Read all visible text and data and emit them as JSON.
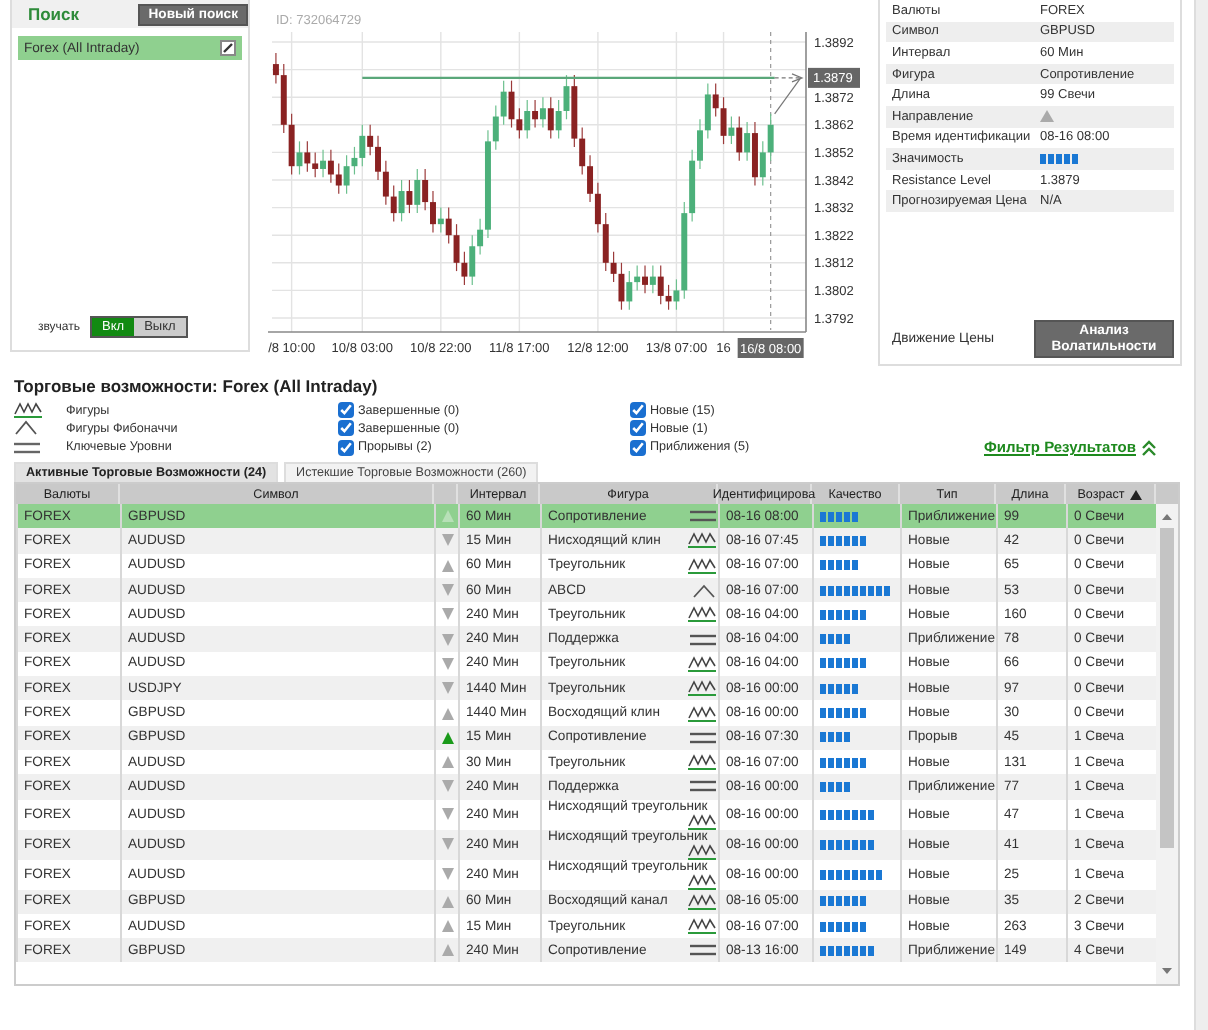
{
  "search_panel": {
    "title": "Поиск",
    "new_search_button": "Новый поиск",
    "items": [
      {
        "label": "Forex (All Intraday)",
        "selected": true
      }
    ],
    "sound_label": "звучать",
    "sound_options": [
      {
        "label": "Вкл",
        "selected": true
      },
      {
        "label": "Выкл",
        "selected": false
      }
    ]
  },
  "chart": {
    "id_label": "ID: 732064729",
    "chart_data": {
      "type": "candlestick",
      "ylim": [
        1.3792,
        1.3892
      ],
      "grid": true,
      "categories": [
        null,
        null,
        "/8 10:00",
        null,
        null,
        null,
        null,
        null,
        null,
        null,
        null,
        "10/8 03:00",
        null,
        null,
        null,
        null,
        null,
        null,
        null,
        null,
        null,
        "10/8 22:00",
        null,
        null,
        null,
        null,
        null,
        null,
        null,
        null,
        null,
        "11/8 17:00",
        null,
        null,
        null,
        null,
        null,
        null,
        null,
        null,
        null,
        "12/8 12:00",
        null,
        null,
        null,
        null,
        null,
        null,
        null,
        null,
        null,
        "13/8 07:00",
        null,
        null,
        null,
        null,
        null,
        "16",
        null,
        null,
        null,
        null,
        null,
        "16/8 08:00",
        null,
        null,
        null,
        null
      ],
      "yticks": [
        1.3892,
        1.3872,
        1.3862,
        1.3852,
        1.3842,
        1.3832,
        1.3822,
        1.3812,
        1.3802,
        1.3792
      ],
      "ref_lines": [
        {
          "axis": "y",
          "value": 1.3879,
          "label": "1.3879",
          "color": "#5aa77a"
        }
      ],
      "ohlc": [
        [
          1.3884,
          1.3888,
          1.3877,
          1.388
        ],
        [
          1.388,
          1.3884,
          1.3859,
          1.3862
        ],
        [
          1.3862,
          1.3866,
          1.3844,
          1.3847
        ],
        [
          1.3847,
          1.3856,
          1.3844,
          1.3852
        ],
        [
          1.3852,
          1.3856,
          1.3845,
          1.3848
        ],
        [
          1.3848,
          1.3852,
          1.3843,
          1.3846
        ],
        [
          1.3846,
          1.3853,
          1.3843,
          1.3849
        ],
        [
          1.3849,
          1.3853,
          1.3841,
          1.3844
        ],
        [
          1.3844,
          1.3848,
          1.3837,
          1.384
        ],
        [
          1.384,
          1.3851,
          1.3837,
          1.3847
        ],
        [
          1.3847,
          1.3854,
          1.3844,
          1.385
        ],
        [
          1.385,
          1.3862,
          1.3847,
          1.3858
        ],
        [
          1.3858,
          1.3862,
          1.3851,
          1.3854
        ],
        [
          1.3854,
          1.3858,
          1.3842,
          1.3845
        ],
        [
          1.3845,
          1.3849,
          1.3833,
          1.3836
        ],
        [
          1.3836,
          1.384,
          1.3827,
          1.383
        ],
        [
          1.383,
          1.3842,
          1.3827,
          1.3838
        ],
        [
          1.3838,
          1.3842,
          1.383,
          1.3833
        ],
        [
          1.3833,
          1.3846,
          1.383,
          1.3842
        ],
        [
          1.3842,
          1.3846,
          1.3831,
          1.3834
        ],
        [
          1.3834,
          1.3838,
          1.3823,
          1.3826
        ],
        [
          1.3826,
          1.3832,
          1.3823,
          1.3828
        ],
        [
          1.3828,
          1.3832,
          1.3819,
          1.3822
        ],
        [
          1.3822,
          1.3826,
          1.3809,
          1.3812
        ],
        [
          1.3812,
          1.3816,
          1.3804,
          1.3807
        ],
        [
          1.3807,
          1.3822,
          1.3804,
          1.3818
        ],
        [
          1.3818,
          1.3828,
          1.3815,
          1.3824
        ],
        [
          1.3824,
          1.386,
          1.3821,
          1.3856
        ],
        [
          1.3856,
          1.3869,
          1.3853,
          1.3865
        ],
        [
          1.3865,
          1.3878,
          1.3862,
          1.3874
        ],
        [
          1.3874,
          1.3878,
          1.3861,
          1.3864
        ],
        [
          1.3864,
          1.3868,
          1.3857,
          1.386
        ],
        [
          1.386,
          1.3871,
          1.3857,
          1.3867
        ],
        [
          1.3867,
          1.3871,
          1.3861,
          1.3864
        ],
        [
          1.3864,
          1.3872,
          1.3861,
          1.3868
        ],
        [
          1.3868,
          1.3872,
          1.3857,
          1.386
        ],
        [
          1.386,
          1.3871,
          1.3857,
          1.3867
        ],
        [
          1.3867,
          1.388,
          1.3864,
          1.3876
        ],
        [
          1.3876,
          1.388,
          1.3854,
          1.3857
        ],
        [
          1.3857,
          1.3861,
          1.3844,
          1.3847
        ],
        [
          1.3847,
          1.3851,
          1.3834,
          1.3837
        ],
        [
          1.3837,
          1.3841,
          1.3823,
          1.3826
        ],
        [
          1.3826,
          1.383,
          1.3809,
          1.3812
        ],
        [
          1.3812,
          1.3816,
          1.3805,
          1.3808
        ],
        [
          1.3808,
          1.3812,
          1.3795,
          1.3798
        ],
        [
          1.3798,
          1.3809,
          1.3795,
          1.3805
        ],
        [
          1.3805,
          1.3811,
          1.3802,
          1.3807
        ],
        [
          1.3807,
          1.3811,
          1.3801,
          1.3804
        ],
        [
          1.3804,
          1.3811,
          1.3801,
          1.3807
        ],
        [
          1.3807,
          1.3811,
          1.3797,
          1.38
        ],
        [
          1.38,
          1.3804,
          1.3795,
          1.3798
        ],
        [
          1.3798,
          1.3806,
          1.3795,
          1.3802
        ],
        [
          1.3802,
          1.3834,
          1.3799,
          1.383
        ],
        [
          1.383,
          1.3853,
          1.3827,
          1.3849
        ],
        [
          1.3849,
          1.3864,
          1.3846,
          1.386
        ],
        [
          1.386,
          1.3877,
          1.3857,
          1.3873
        ],
        [
          1.3873,
          1.3877,
          1.3865,
          1.3868
        ],
        [
          1.3868,
          1.3872,
          1.3855,
          1.3858
        ],
        [
          1.3858,
          1.3865,
          1.3855,
          1.3861
        ],
        [
          1.3861,
          1.3865,
          1.3849,
          1.3852
        ],
        [
          1.3852,
          1.3863,
          1.3849,
          1.3859
        ],
        [
          1.3859,
          1.3863,
          1.384,
          1.3843
        ],
        [
          1.3843,
          1.3856,
          1.384,
          1.3852
        ],
        [
          1.3852,
          1.3866,
          1.3849,
          1.3862
        ],
        null,
        null,
        null,
        null
      ]
    }
  },
  "details": {
    "rows": [
      {
        "label": "Валюты",
        "kind": "text",
        "value": "FOREX"
      },
      {
        "label": "Символ",
        "kind": "text",
        "value": "GBPUSD"
      },
      {
        "label": "Интервал",
        "kind": "text",
        "value": "60 Мин"
      },
      {
        "label": "Фигура",
        "kind": "text",
        "value": "Сопротивление"
      },
      {
        "label": "Длина",
        "kind": "text",
        "value": "99 Свечи"
      },
      {
        "label": "Направление",
        "kind": "direction",
        "up": true
      },
      {
        "label": "Время идентификации",
        "kind": "text",
        "value": "08-16 08:00"
      },
      {
        "label": "Значимость",
        "kind": "quality",
        "stars": 5
      },
      {
        "label": "Resistance Level",
        "kind": "text",
        "value": "1.3879"
      },
      {
        "label": "Прогнозируемая Цена",
        "kind": "text",
        "value": "N/A"
      }
    ],
    "footer_label": "Движение Цены",
    "volatility_button": "Анализ Волатильности"
  },
  "opportunities": {
    "title": "Торговые возможности: Forex (All Intraday)",
    "filters": [
      {
        "label": "Фигуры",
        "kind": "pattern",
        "options": [
          {
            "label": "Завершенные (0)",
            "checked": true
          },
          {
            "label": "Новые (15)",
            "checked": true
          }
        ]
      },
      {
        "label": "Фигуры Фибоначчи",
        "kind": "fib",
        "options": [
          {
            "label": "Завершенные (0)",
            "checked": true
          },
          {
            "label": "Новые (1)",
            "checked": true
          }
        ]
      },
      {
        "label": "Ключевые Уровни",
        "kind": "level",
        "options": [
          {
            "label": "Прорывы (2)",
            "checked": true
          },
          {
            "label": "Приближения (5)",
            "checked": true
          }
        ]
      }
    ],
    "filter_link": "Фильтр Результатов"
  },
  "tabs": [
    {
      "label": "Активные Торговые Возможности (24)",
      "selected": true
    },
    {
      "label": "Истекшие Торговые Возможности (260)",
      "selected": false
    }
  ],
  "table": {
    "columns": [
      {
        "label": "Валюты",
        "sorted": false
      },
      {
        "label": "Символ",
        "sorted": false
      },
      {
        "label": "Интервал",
        "sorted": false
      },
      {
        "label": "Фигура",
        "sorted": false
      },
      {
        "label": "Идентифицирова",
        "sorted": false
      },
      {
        "label": "Качество",
        "sorted": false
      },
      {
        "label": "Тип",
        "sorted": false
      },
      {
        "label": "Длина",
        "sorted": false
      },
      {
        "label": "Возраст",
        "sorted": true
      }
    ],
    "rows": [
      {
        "market": "FOREX",
        "symbol": "GBPUSD",
        "up": true,
        "breakout": false,
        "interval": "60 Мин",
        "figure": {
          "name": "Сопротивление",
          "kind": "level"
        },
        "identified": "08-16 08:00",
        "stars": 5,
        "type": "Приближение",
        "length": "99",
        "age": "0 Свечи",
        "selected": true
      },
      {
        "market": "FOREX",
        "symbol": "AUDUSD",
        "up": false,
        "breakout": false,
        "interval": "15 Мин",
        "figure": {
          "name": "Нисходящий клин",
          "kind": "pattern"
        },
        "identified": "08-16 07:45",
        "stars": 6,
        "type": "Новые",
        "length": "42",
        "age": "0 Свечи",
        "selected": false
      },
      {
        "market": "FOREX",
        "symbol": "AUDUSD",
        "up": true,
        "breakout": false,
        "interval": "60 Мин",
        "figure": {
          "name": "Треугольник",
          "kind": "pattern"
        },
        "identified": "08-16 07:00",
        "stars": 5,
        "type": "Новые",
        "length": "65",
        "age": "0 Свечи",
        "selected": false
      },
      {
        "market": "FOREX",
        "symbol": "AUDUSD",
        "up": false,
        "breakout": false,
        "interval": "60 Мин",
        "figure": {
          "name": "ABCD",
          "kind": "fib"
        },
        "identified": "08-16 07:00",
        "stars": 9,
        "type": "Новые",
        "length": "53",
        "age": "0 Свечи",
        "selected": false
      },
      {
        "market": "FOREX",
        "symbol": "AUDUSD",
        "up": false,
        "breakout": false,
        "interval": "240 Мин",
        "figure": {
          "name": "Треугольник",
          "kind": "pattern"
        },
        "identified": "08-16 04:00",
        "stars": 6,
        "type": "Новые",
        "length": "160",
        "age": "0 Свечи",
        "selected": false
      },
      {
        "market": "FOREX",
        "symbol": "AUDUSD",
        "up": false,
        "breakout": false,
        "interval": "240 Мин",
        "figure": {
          "name": "Поддержка",
          "kind": "level"
        },
        "identified": "08-16 04:00",
        "stars": 4,
        "type": "Приближение",
        "length": "78",
        "age": "0 Свечи",
        "selected": false
      },
      {
        "market": "FOREX",
        "symbol": "AUDUSD",
        "up": false,
        "breakout": false,
        "interval": "240 Мин",
        "figure": {
          "name": "Треугольник",
          "kind": "pattern"
        },
        "identified": "08-16 04:00",
        "stars": 6,
        "type": "Новые",
        "length": "66",
        "age": "0 Свечи",
        "selected": false
      },
      {
        "market": "FOREX",
        "symbol": "USDJPY",
        "up": false,
        "breakout": false,
        "interval": "1440 Мин",
        "figure": {
          "name": "Треугольник",
          "kind": "pattern"
        },
        "identified": "08-16 00:00",
        "stars": 5,
        "type": "Новые",
        "length": "97",
        "age": "0 Свечи",
        "selected": false
      },
      {
        "market": "FOREX",
        "symbol": "GBPUSD",
        "up": true,
        "breakout": false,
        "interval": "1440 Мин",
        "figure": {
          "name": "Восходящий клин",
          "kind": "pattern"
        },
        "identified": "08-16 00:00",
        "stars": 6,
        "type": "Новые",
        "length": "30",
        "age": "0 Свечи",
        "selected": false
      },
      {
        "market": "FOREX",
        "symbol": "GBPUSD",
        "up": true,
        "breakout": true,
        "interval": "15 Мин",
        "figure": {
          "name": "Сопротивление",
          "kind": "level"
        },
        "identified": "08-16 07:30",
        "stars": 4,
        "type": "Прорыв",
        "length": "45",
        "age": "1 Свеча",
        "selected": false
      },
      {
        "market": "FOREX",
        "symbol": "AUDUSD",
        "up": true,
        "breakout": false,
        "interval": "30 Мин",
        "figure": {
          "name": "Треугольник",
          "kind": "pattern"
        },
        "identified": "08-16 07:00",
        "stars": 6,
        "type": "Новые",
        "length": "131",
        "age": "1 Свеча",
        "selected": false
      },
      {
        "market": "FOREX",
        "symbol": "AUDUSD",
        "up": false,
        "breakout": false,
        "interval": "240 Мин",
        "figure": {
          "name": "Поддержка",
          "kind": "level"
        },
        "identified": "08-16 00:00",
        "stars": 4,
        "type": "Приближение",
        "length": "77",
        "age": "1 Свеча",
        "selected": false
      },
      {
        "market": "FOREX",
        "symbol": "AUDUSD",
        "up": false,
        "breakout": false,
        "interval": "240 Мин",
        "figure": {
          "name": "Нисходящий треугольник",
          "kind": "pattern"
        },
        "identified": "08-16 00:00",
        "stars": 7,
        "type": "Новые",
        "length": "47",
        "age": "1 Свеча",
        "selected": false
      },
      {
        "market": "FOREX",
        "symbol": "AUDUSD",
        "up": false,
        "breakout": false,
        "interval": "240 Мин",
        "figure": {
          "name": "Нисходящий треугольник",
          "kind": "pattern"
        },
        "identified": "08-16 00:00",
        "stars": 7,
        "type": "Новые",
        "length": "41",
        "age": "1 Свеча",
        "selected": false
      },
      {
        "market": "FOREX",
        "symbol": "AUDUSD",
        "up": false,
        "breakout": false,
        "interval": "240 Мин",
        "figure": {
          "name": "Нисходящий треугольник",
          "kind": "pattern"
        },
        "identified": "08-16 00:00",
        "stars": 8,
        "type": "Новые",
        "length": "25",
        "age": "1 Свеча",
        "selected": false
      },
      {
        "market": "FOREX",
        "symbol": "GBPUSD",
        "up": true,
        "breakout": false,
        "interval": "60 Мин",
        "figure": {
          "name": "Восходящий канал",
          "kind": "pattern"
        },
        "identified": "08-16 05:00",
        "stars": 6,
        "type": "Новые",
        "length": "35",
        "age": "2 Свечи",
        "selected": false
      },
      {
        "market": "FOREX",
        "symbol": "AUDUSD",
        "up": true,
        "breakout": false,
        "interval": "15 Мин",
        "figure": {
          "name": "Треугольник",
          "kind": "pattern"
        },
        "identified": "08-16 07:00",
        "stars": 6,
        "type": "Новые",
        "length": "263",
        "age": "3 Свечи",
        "selected": false
      },
      {
        "market": "FOREX",
        "symbol": "GBPUSD",
        "up": true,
        "breakout": false,
        "interval": "240 Мин",
        "figure": {
          "name": "Сопротивление",
          "kind": "level"
        },
        "identified": "08-13 16:00",
        "stars": 7,
        "type": "Приближение",
        "length": "149",
        "age": "4 Свечи",
        "selected": false
      }
    ]
  }
}
